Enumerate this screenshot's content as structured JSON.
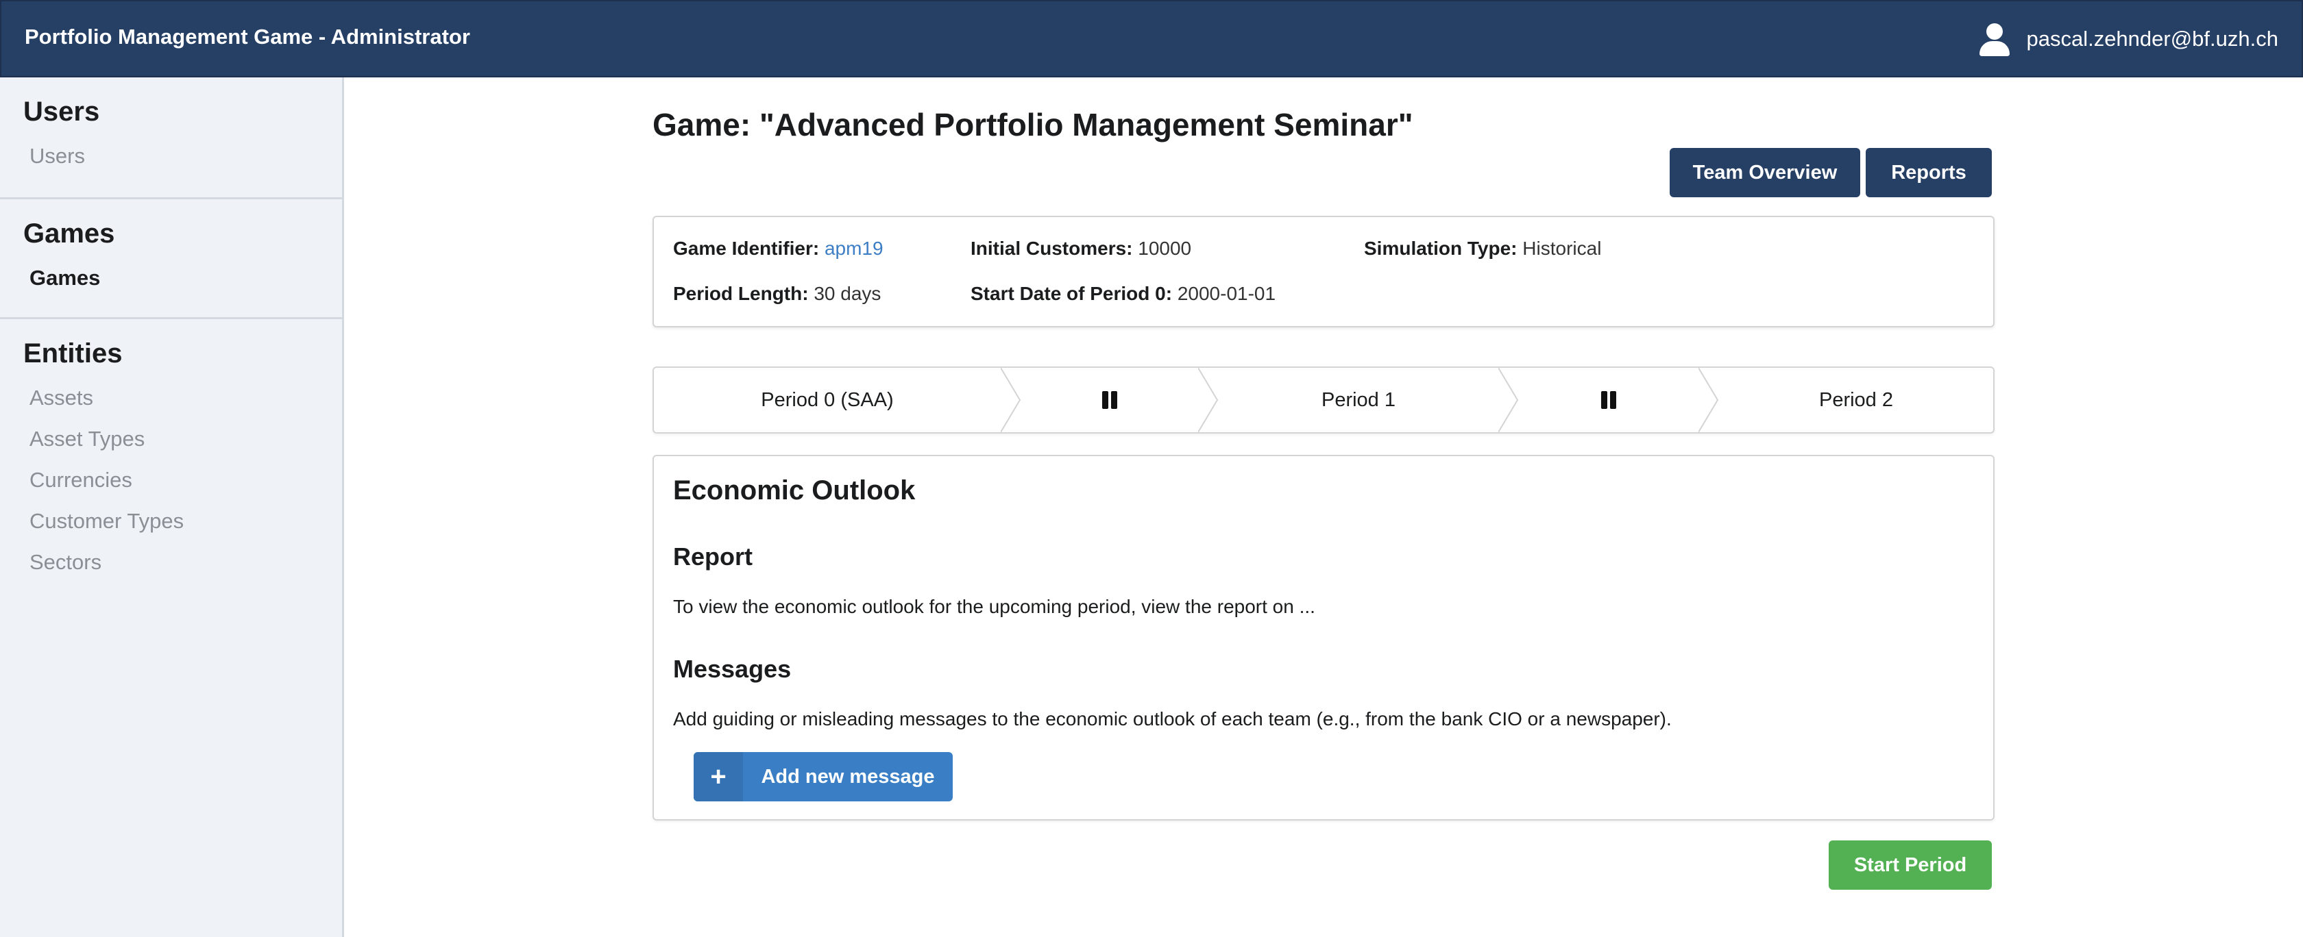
{
  "header": {
    "app_title": "Portfolio Management Game - Administrator",
    "user_icon": "user-icon",
    "user_email": "pascal.zehnder@bf.uzh.ch"
  },
  "sidebar": {
    "sections": [
      {
        "header": "Users",
        "items": [
          {
            "label": "Users",
            "active": false
          }
        ]
      },
      {
        "header": "Games",
        "items": [
          {
            "label": "Games",
            "active": true
          }
        ]
      },
      {
        "header": "Entities",
        "items": [
          {
            "label": "Assets",
            "active": false
          },
          {
            "label": "Asset Types",
            "active": false
          },
          {
            "label": "Currencies",
            "active": false
          },
          {
            "label": "Customer Types",
            "active": false
          },
          {
            "label": "Sectors",
            "active": false
          }
        ]
      }
    ]
  },
  "main": {
    "title": "Game: \"Advanced Portfolio Management Seminar\"",
    "buttons": {
      "team_overview": "Team Overview",
      "reports": "Reports"
    },
    "info": {
      "game_identifier_label": "Game Identifier:",
      "game_identifier_value": "apm19",
      "initial_customers_label": "Initial Customers:",
      "initial_customers_value": "10000",
      "simulation_type_label": "Simulation Type:",
      "simulation_type_value": "Historical",
      "period_length_label": "Period Length:",
      "period_length_value": "30 days",
      "start_date_label": "Start Date of Period 0:",
      "start_date_value": "2000-01-01"
    },
    "steps": [
      {
        "label": "Period 0 (SAA)",
        "icon": ""
      },
      {
        "label": "",
        "icon": "pause-icon"
      },
      {
        "label": "Period 1",
        "icon": ""
      },
      {
        "label": "",
        "icon": "pause-icon"
      },
      {
        "label": "Period 2",
        "icon": ""
      }
    ],
    "outlook": {
      "title": "Economic Outlook",
      "report_heading": "Report",
      "report_text": "To view the economic outlook for the upcoming period, view the report on ...",
      "messages_heading": "Messages",
      "messages_text": "Add guiding or misleading messages to the economic outlook of each team (e.g., from the bank CIO or a newspaper).",
      "add_button": "Add new message",
      "add_icon": "plus-icon"
    },
    "start_button": "Start Period"
  },
  "colors": {
    "header_bg": "#263f64",
    "sidebar_bg": "#eff2f7",
    "link": "#3d7ec4",
    "primary_button": "#3a7fc6",
    "success_button": "#53b153"
  }
}
